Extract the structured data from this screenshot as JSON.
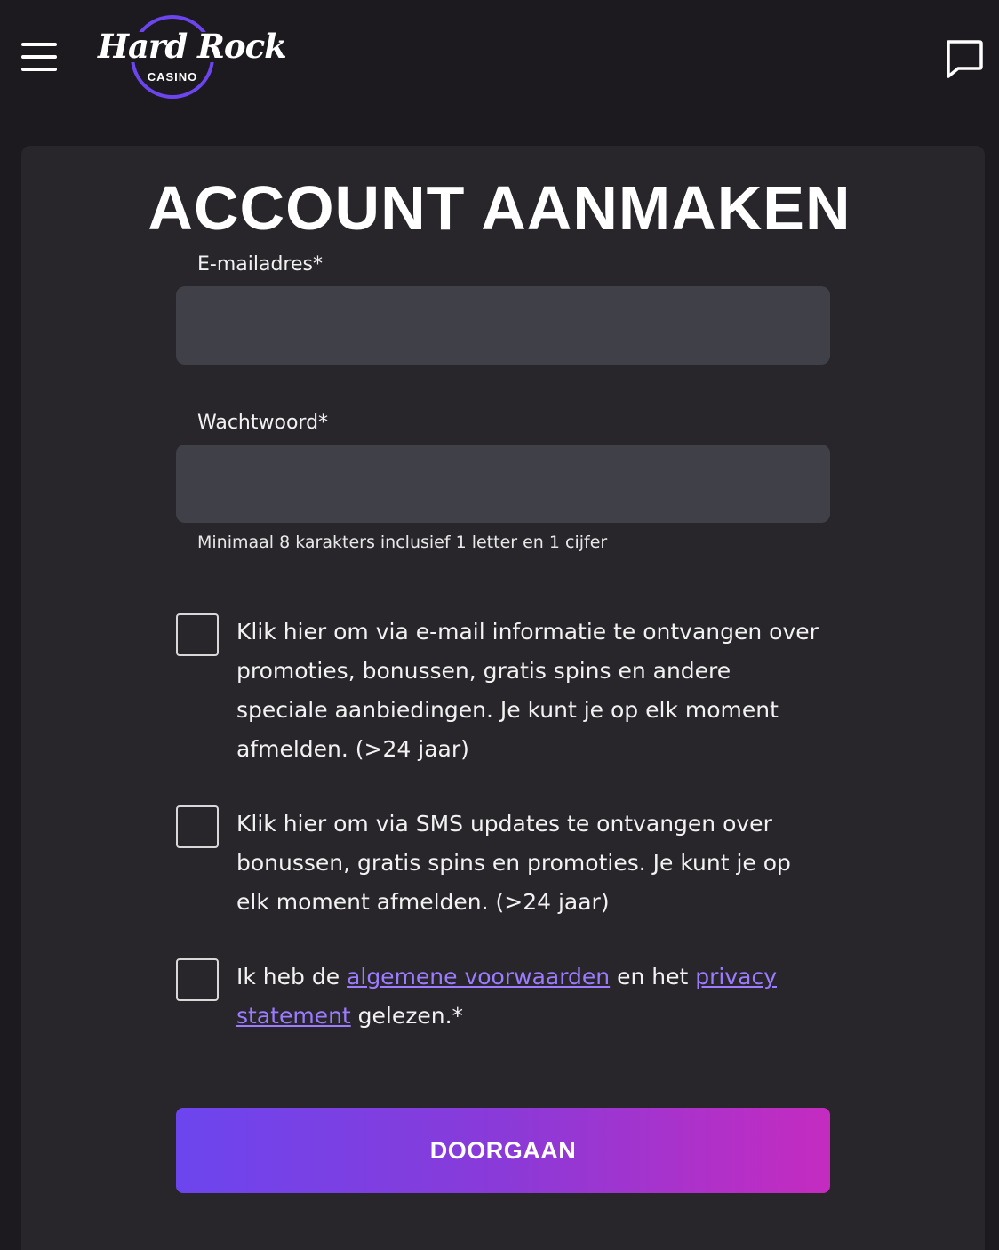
{
  "header": {
    "logo_title": "Hard Rock",
    "logo_subtitle": "CASINO",
    "menu_icon": "hamburger-icon",
    "chat_icon": "chat-bubble-icon"
  },
  "form": {
    "title": "ACCOUNT AANMAKEN",
    "email_label": "E-mailadres*",
    "email_value": "",
    "password_label": "Wachtwoord*",
    "password_value": "",
    "password_hint": "Minimaal 8 karakters inclusief 1 letter en 1 cijfer",
    "consents": [
      {
        "text": "Klik hier om via e-mail informatie te ontvangen over promoties, bonussen, gratis spins en andere speciale aanbiedingen. Je kunt je op elk moment afmelden. (>24 jaar)",
        "checked": false
      },
      {
        "text": "Klik hier om via SMS updates te ontvangen over bonussen, gratis spins en promoties. Je kunt je op elk moment afmelden. (>24 jaar)",
        "checked": false
      },
      {
        "text_before": "Ik heb de ",
        "link1": "algemene voorwaarden",
        "text_middle": " en het ",
        "link2": "privacy statement",
        "text_after": " gelezen.*",
        "checked": false
      }
    ],
    "submit_label": "DOORGAAN"
  },
  "colors": {
    "background": "#1c1a1f",
    "card": "#28262b",
    "input": "#3f4048",
    "link": "#9c7bff",
    "brand_purple": "#6c45ee",
    "button_gradient_end": "#c52bc0"
  }
}
